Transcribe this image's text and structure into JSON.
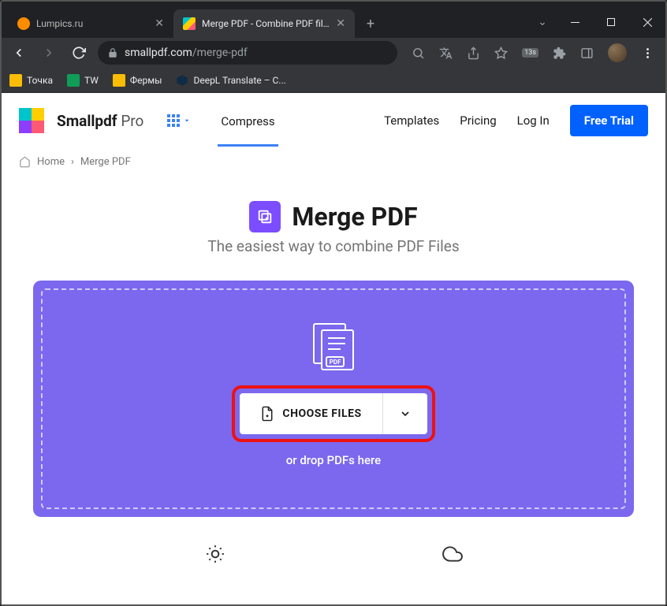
{
  "browser": {
    "tabs": [
      {
        "title": "Lumpics.ru",
        "active": false
      },
      {
        "title": "Merge PDF - Combine PDF files o",
        "active": true
      }
    ],
    "url_domain": "smallpdf.com",
    "url_path": "/merge-pdf",
    "ext_badge": "13s"
  },
  "bookmarks": [
    {
      "label": "Точка"
    },
    {
      "label": "TW"
    },
    {
      "label": "Фермы"
    },
    {
      "label": "DeepL Translate – С..."
    }
  ],
  "header": {
    "brand": "Smallpdf",
    "brand_suffix": "Pro",
    "compress": "Compress",
    "templates": "Templates",
    "pricing": "Pricing",
    "login": "Log In",
    "free_trial": "Free Trial"
  },
  "breadcrumb": {
    "home": "Home",
    "sep": "›",
    "current": "Merge PDF"
  },
  "hero": {
    "title": "Merge PDF",
    "subtitle": "The easiest way to combine PDF Files"
  },
  "dropzone": {
    "choose": "CHOOSE FILES",
    "or_drop": "or drop PDFs here"
  }
}
